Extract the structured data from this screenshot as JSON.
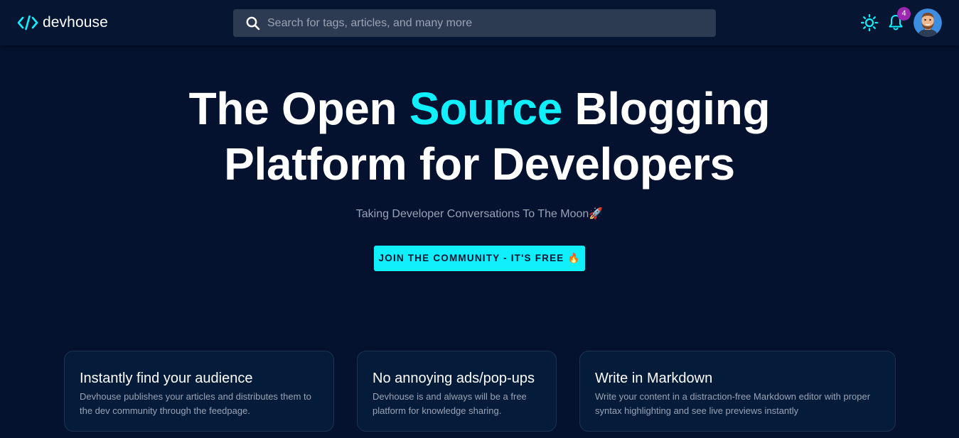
{
  "brand": {
    "name": "devhouse",
    "accent_color": "#0ff0fc",
    "background_color": "#041230"
  },
  "search": {
    "placeholder": "Search for tags, articles, and many more",
    "value": ""
  },
  "header_icons": {
    "theme": "sun-icon",
    "notifications": "bell-icon",
    "search": "search-icon"
  },
  "notifications": {
    "count": "4",
    "badge_color": "#9c27b0"
  },
  "hero": {
    "title_part1": "The Open ",
    "title_highlight": "Source",
    "title_part2": " Blogging",
    "title_line2": "Platform for Developers",
    "subtitle": "Taking Developer Conversations To The Moon🚀",
    "cta_label": "JOIN THE COMMUNITY - IT'S FREE 🔥"
  },
  "features": [
    {
      "title": "Instantly find your audience",
      "description": "Devhouse publishes your articles and distributes them to the dev community through the feedpage."
    },
    {
      "title": "No annoying ads/pop-ups",
      "description": "Devhouse is and always will be a free platform for knowledge sharing."
    },
    {
      "title": "Write in Markdown",
      "description": "Write your content in a distraction-free Markdown editor with proper syntax highlighting and see live previews instantly"
    }
  ]
}
